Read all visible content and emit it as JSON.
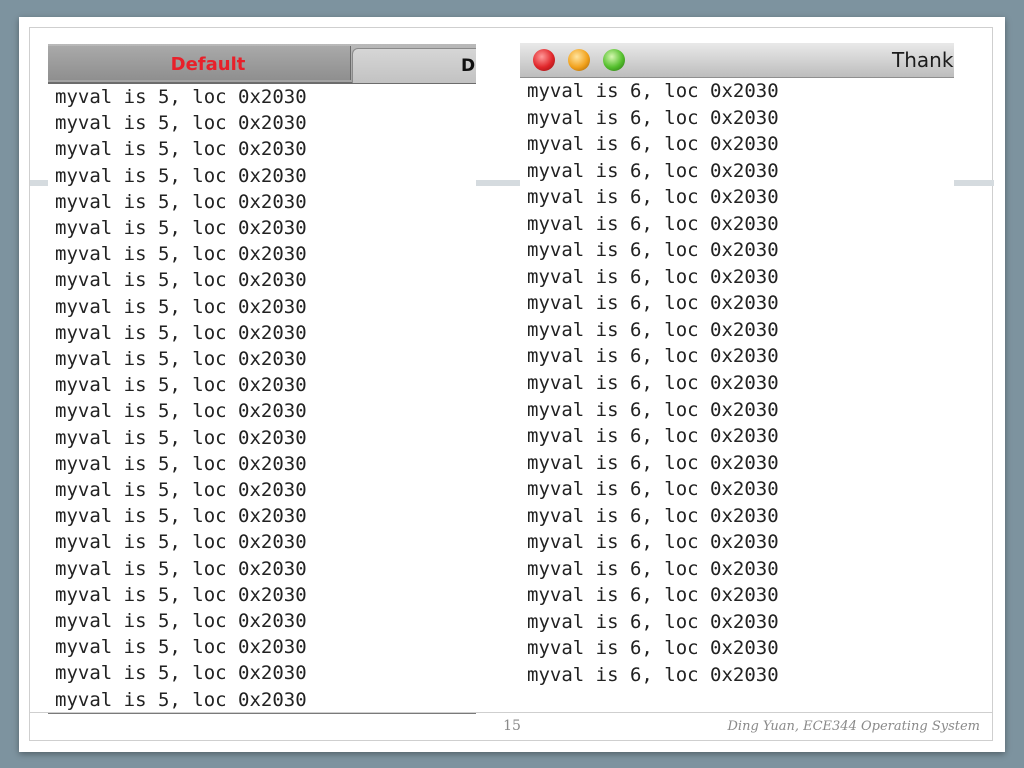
{
  "left_terminal": {
    "tabs": [
      {
        "label": "Default",
        "active": true
      },
      {
        "label": "D",
        "active": false
      }
    ],
    "lines": [
      "myval is 5, loc 0x2030",
      "myval is 5, loc 0x2030",
      "myval is 5, loc 0x2030",
      "myval is 5, loc 0x2030",
      "myval is 5, loc 0x2030",
      "myval is 5, loc 0x2030",
      "myval is 5, loc 0x2030",
      "myval is 5, loc 0x2030",
      "myval is 5, loc 0x2030",
      "myval is 5, loc 0x2030",
      "myval is 5, loc 0x2030",
      "myval is 5, loc 0x2030",
      "myval is 5, loc 0x2030",
      "myval is 5, loc 0x2030",
      "myval is 5, loc 0x2030",
      "myval is 5, loc 0x2030",
      "myval is 5, loc 0x2030",
      "myval is 5, loc 0x2030",
      "myval is 5, loc 0x2030",
      "myval is 5, loc 0x2030",
      "myval is 5, loc 0x2030",
      "myval is 5, loc 0x2030",
      "myval is 5, loc 0x2030",
      "myval is 5, loc 0x2030"
    ]
  },
  "right_terminal": {
    "title": "Thank",
    "lines": [
      "myval is 6, loc 0x2030",
      "myval is 6, loc 0x2030",
      "myval is 6, loc 0x2030",
      "myval is 6, loc 0x2030",
      "myval is 6, loc 0x2030",
      "myval is 6, loc 0x2030",
      "myval is 6, loc 0x2030",
      "myval is 6, loc 0x2030",
      "myval is 6, loc 0x2030",
      "myval is 6, loc 0x2030",
      "myval is 6, loc 0x2030",
      "myval is 6, loc 0x2030",
      "myval is 6, loc 0x2030",
      "myval is 6, loc 0x2030",
      "myval is 6, loc 0x2030",
      "myval is 6, loc 0x2030",
      "myval is 6, loc 0x2030",
      "myval is 6, loc 0x2030",
      "myval is 6, loc 0x2030",
      "myval is 6, loc 0x2030",
      "myval is 6, loc 0x2030",
      "myval is 6, loc 0x2030",
      "myval is 6, loc 0x2030",
      "myval is 6, loc 0x2030"
    ]
  },
  "footer": {
    "page_number": "15",
    "text": "Ding Yuan, ECE344 Operating System"
  },
  "colors": {
    "background": "#7d939f",
    "active_tab_label": "#e8202a",
    "terminal_text": "#222222"
  }
}
